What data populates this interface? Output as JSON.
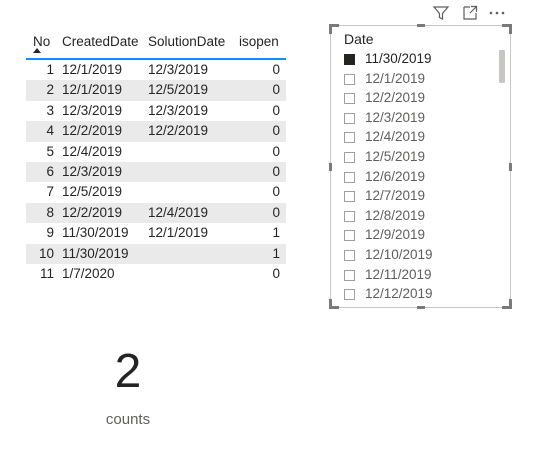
{
  "table": {
    "headers": {
      "no": "No",
      "created": "CreatedDate",
      "solution": "SolutionDate",
      "isopen": "isopen"
    },
    "rows": [
      {
        "no": "1",
        "created": "12/1/2019",
        "solution": "12/3/2019",
        "isopen": "0"
      },
      {
        "no": "2",
        "created": "12/1/2019",
        "solution": "12/5/2019",
        "isopen": "0"
      },
      {
        "no": "3",
        "created": "12/3/2019",
        "solution": "12/3/2019",
        "isopen": "0"
      },
      {
        "no": "4",
        "created": "12/2/2019",
        "solution": "12/2/2019",
        "isopen": "0"
      },
      {
        "no": "5",
        "created": "12/4/2019",
        "solution": "",
        "isopen": "0"
      },
      {
        "no": "6",
        "created": "12/3/2019",
        "solution": "",
        "isopen": "0"
      },
      {
        "no": "7",
        "created": "12/5/2019",
        "solution": "",
        "isopen": "0"
      },
      {
        "no": "8",
        "created": "12/2/2019",
        "solution": "12/4/2019",
        "isopen": "0"
      },
      {
        "no": "9",
        "created": "11/30/2019",
        "solution": "12/1/2019",
        "isopen": "1"
      },
      {
        "no": "10",
        "created": "11/30/2019",
        "solution": "",
        "isopen": "1"
      },
      {
        "no": "11",
        "created": "1/7/2020",
        "solution": "",
        "isopen": "0"
      }
    ]
  },
  "slicer": {
    "title": "Date",
    "items": [
      {
        "label": "11/30/2019",
        "selected": true
      },
      {
        "label": "12/1/2019",
        "selected": false
      },
      {
        "label": "12/2/2019",
        "selected": false
      },
      {
        "label": "12/3/2019",
        "selected": false
      },
      {
        "label": "12/4/2019",
        "selected": false
      },
      {
        "label": "12/5/2019",
        "selected": false
      },
      {
        "label": "12/6/2019",
        "selected": false
      },
      {
        "label": "12/7/2019",
        "selected": false
      },
      {
        "label": "12/8/2019",
        "selected": false
      },
      {
        "label": "12/9/2019",
        "selected": false
      },
      {
        "label": "12/10/2019",
        "selected": false
      },
      {
        "label": "12/11/2019",
        "selected": false
      },
      {
        "label": "12/12/2019",
        "selected": false
      }
    ],
    "header_icons": [
      "filter-icon",
      "focus-mode-icon",
      "more-options-icon"
    ]
  },
  "card": {
    "value": "2",
    "label": "counts"
  },
  "colors": {
    "accent": "#118dff",
    "alt_row": "#eaeaea",
    "text": "#252423"
  }
}
